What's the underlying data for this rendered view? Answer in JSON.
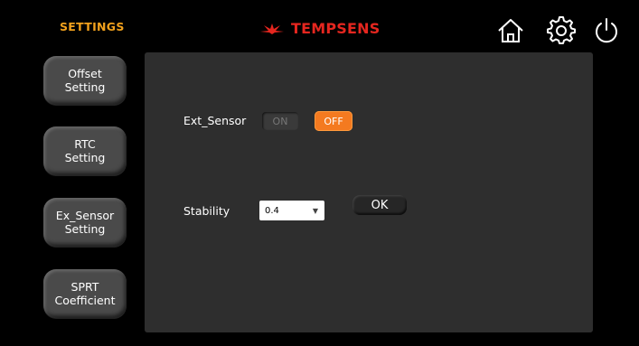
{
  "header": {
    "title": "SETTINGS",
    "brand": "TEMPSENS",
    "icons": [
      "home-icon",
      "gear-icon",
      "power-icon"
    ]
  },
  "sidebar": {
    "items": [
      {
        "label": "Offset\nSetting"
      },
      {
        "label": "RTC\nSetting"
      },
      {
        "label": "Ex_Sensor\nSetting"
      },
      {
        "label": "SPRT\nCoefficient"
      }
    ]
  },
  "ext_sensor": {
    "label": "Ext_Sensor",
    "on_label": "ON",
    "off_label": "OFF",
    "state": "OFF"
  },
  "stability": {
    "label": "Stability",
    "value": "0.4",
    "ok_label": "OK"
  },
  "colors": {
    "accent": "#f47a20",
    "title": "#f3a21d",
    "brand": "#e5261f",
    "panel": "#2e2e2e"
  }
}
